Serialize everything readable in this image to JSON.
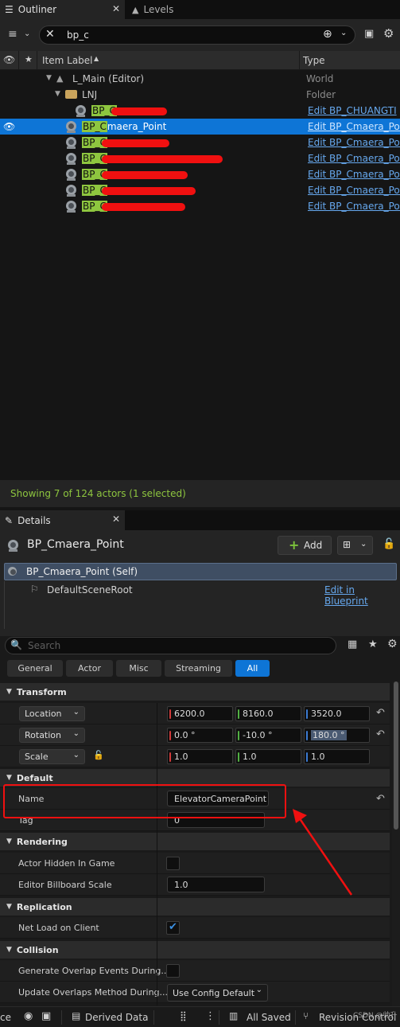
{
  "outliner": {
    "tab_label": "Outliner",
    "levels_tab_label": "Levels",
    "search_value": "bp_c",
    "col_item_label": "Item Label",
    "col_type": "Type",
    "rows": [
      {
        "label": "L_Main (Editor)",
        "type": "World"
      },
      {
        "label": "LNJ",
        "type": "Folder"
      },
      {
        "label_hl": "BP_C",
        "label_rest": "",
        "type": "Edit BP_CHUANGTI"
      },
      {
        "label_hl": "BP_C",
        "label_rest": "maera_Point",
        "type": "Edit BP_Cmaera_Point"
      },
      {
        "label_hl": "BP_C",
        "label_rest": "",
        "type": "Edit BP_Cmaera_Point"
      },
      {
        "label_hl": "BP_C",
        "label_rest": "",
        "type": "Edit BP_Cmaera_Point"
      },
      {
        "label_hl": "BP_C",
        "label_rest": "",
        "type": "Edit BP_Cmaera_Point"
      },
      {
        "label_hl": "BP_C",
        "label_rest": "",
        "type": "Edit BP_Cmaera_Point"
      },
      {
        "label_hl": "BP_C",
        "label_rest": "",
        "type": "Edit BP_Cmaera_Point"
      }
    ],
    "status_text": "Showing 7 of 124 actors (1 selected)"
  },
  "details": {
    "tab_label": "Details",
    "actor_name": "BP_Cmaera_Point",
    "add_label": "Add",
    "self_label": "BP_Cmaera_Point (Self)",
    "component_label": "DefaultSceneRoot",
    "edit_blueprint_label": "Edit in Blueprint",
    "search_placeholder": "Search",
    "filter_tabs": [
      "General",
      "Actor",
      "Misc",
      "Streaming",
      "All"
    ],
    "transform": {
      "header": "Transform",
      "location_label": "Location",
      "location": [
        "6200.0",
        "8160.0",
        "3520.0"
      ],
      "rotation_label": "Rotation",
      "rotation": [
        "0.0 °",
        "-10.0 °",
        "180.0 °"
      ],
      "scale_label": "Scale",
      "scale": [
        "1.0",
        "1.0",
        "1.0"
      ]
    },
    "default": {
      "header": "Default",
      "name_label": "Name",
      "name_value": "ElevatorCameraPoint",
      "tag_label": "Tag",
      "tag_value": "0"
    },
    "rendering": {
      "header": "Rendering",
      "hidden_label": "Actor Hidden In Game",
      "billboard_label": "Editor Billboard Scale",
      "billboard_value": "1.0"
    },
    "replication": {
      "header": "Replication",
      "net_load_label": "Net Load on Client",
      "net_load_checked": true
    },
    "collision": {
      "header": "Collision",
      "overlap_label": "Generate Overlap Events During...",
      "update_label": "Update Overlaps Method During...",
      "update_value": "Use Config Default"
    }
  },
  "statusbar": {
    "left_partial": "ce",
    "derived_data": "Derived Data",
    "all_saved": "All Saved",
    "revision_control": "Revision Control",
    "watermark": "CSDN @帅升"
  },
  "colors": {
    "selection": "#0e75d6",
    "highlight": "#8ec63f",
    "link": "#66a8ee",
    "annotation_red": "#f01010"
  }
}
